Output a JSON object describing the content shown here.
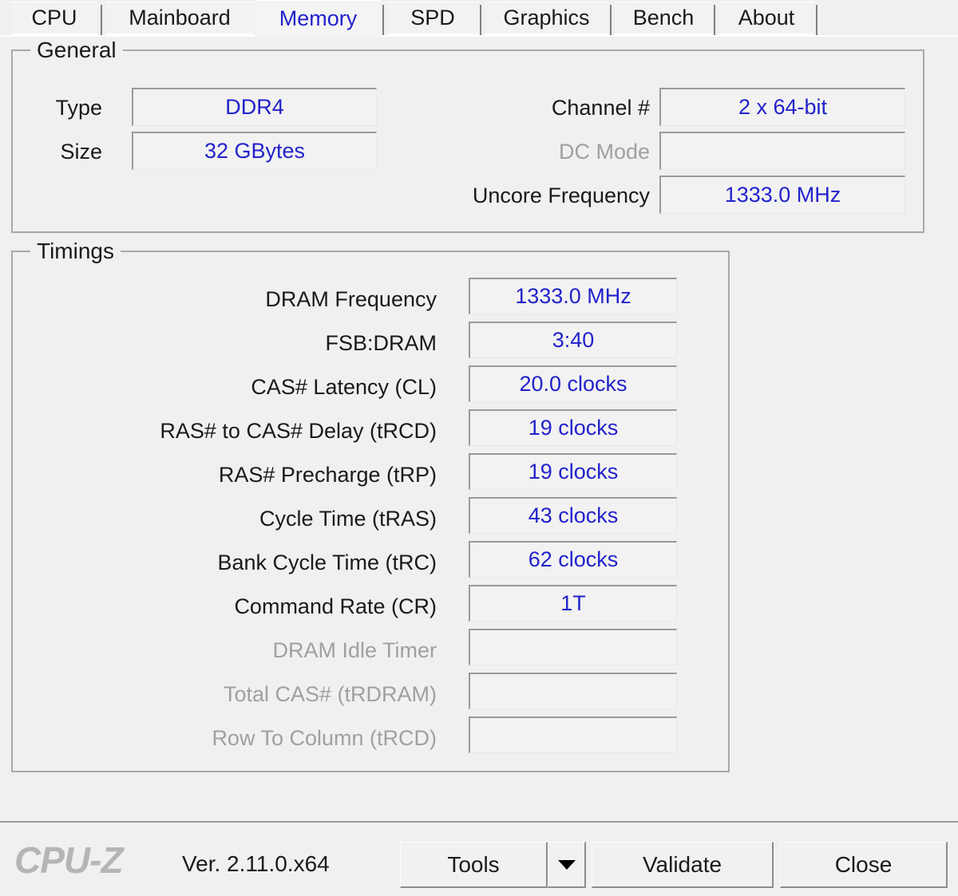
{
  "app": {
    "name": "CPU-Z",
    "logo_text": "CPU-Z",
    "version_text": "Ver. 2.11.0.x64"
  },
  "tabs": [
    {
      "label": "CPU",
      "active": false
    },
    {
      "label": "Mainboard",
      "active": false
    },
    {
      "label": "Memory",
      "active": true
    },
    {
      "label": "SPD",
      "active": false
    },
    {
      "label": "Graphics",
      "active": false
    },
    {
      "label": "Bench",
      "active": false
    },
    {
      "label": "About",
      "active": false
    }
  ],
  "general": {
    "title": "General",
    "left_fields": [
      {
        "label": "Type",
        "value": "DDR4",
        "disabled": false
      },
      {
        "label": "Size",
        "value": "32 GBytes",
        "disabled": false
      }
    ],
    "right_fields": [
      {
        "label": "Channel #",
        "value": "2 x 64-bit",
        "disabled": false
      },
      {
        "label": "DC Mode",
        "value": "",
        "disabled": true
      },
      {
        "label": "Uncore Frequency",
        "value": "1333.0 MHz",
        "disabled": false
      }
    ]
  },
  "timings": {
    "title": "Timings",
    "rows": [
      {
        "label": "DRAM Frequency",
        "value": "1333.0 MHz",
        "disabled": false
      },
      {
        "label": "FSB:DRAM",
        "value": "3:40",
        "disabled": false
      },
      {
        "label": "CAS# Latency (CL)",
        "value": "20.0 clocks",
        "disabled": false
      },
      {
        "label": "RAS# to CAS# Delay (tRCD)",
        "value": "19 clocks",
        "disabled": false
      },
      {
        "label": "RAS# Precharge (tRP)",
        "value": "19 clocks",
        "disabled": false
      },
      {
        "label": "Cycle Time (tRAS)",
        "value": "43 clocks",
        "disabled": false
      },
      {
        "label": "Bank Cycle Time (tRC)",
        "value": "62 clocks",
        "disabled": false
      },
      {
        "label": "Command Rate (CR)",
        "value": "1T",
        "disabled": false
      },
      {
        "label": "DRAM Idle Timer",
        "value": "",
        "disabled": true
      },
      {
        "label": "Total CAS# (tRDRAM)",
        "value": "",
        "disabled": true
      },
      {
        "label": "Row To Column (tRCD)",
        "value": "",
        "disabled": true
      }
    ]
  },
  "footer": {
    "tools_label": "Tools",
    "tools_dropdown_icon": "caret-down-icon",
    "validate_label": "Validate",
    "close_label": "Close"
  },
  "colors": {
    "value_blue": "#2222cc",
    "accent_tab_active": "#2222cc",
    "window_bg": "#f0f0f0",
    "disabled_text": "#a0a0a0"
  }
}
